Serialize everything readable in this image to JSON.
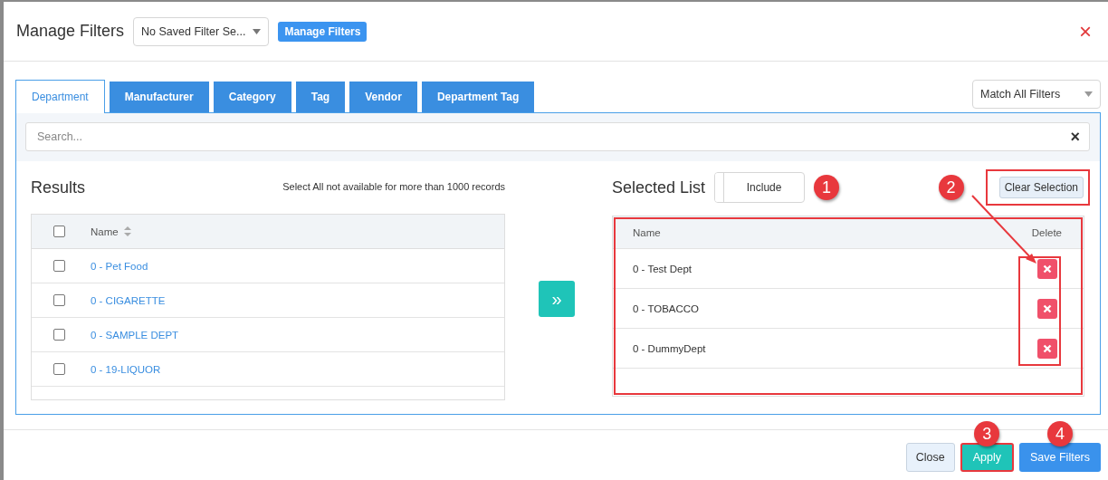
{
  "header": {
    "title": "Manage Filters",
    "saved_filter": "No Saved Filter Se...",
    "manage_button": "Manage Filters",
    "close": "×"
  },
  "tabs": [
    {
      "label": "Department",
      "selected": true
    },
    {
      "label": "Manufacturer",
      "selected": false
    },
    {
      "label": "Category",
      "selected": false
    },
    {
      "label": "Tag",
      "selected": false
    },
    {
      "label": "Vendor",
      "selected": false
    },
    {
      "label": "Department Tag",
      "selected": false
    }
  ],
  "match_select": "Match All Filters",
  "search": {
    "placeholder": "Search...",
    "clear": "×"
  },
  "results": {
    "title": "Results",
    "note": "Select All not available for more than 1000 records",
    "select_all_checked": false,
    "column": "Name",
    "rows": [
      {
        "name": "0 - Pet Food",
        "checked": false
      },
      {
        "name": "0 - CIGARETTE",
        "checked": false
      },
      {
        "name": "0 - SAMPLE DEPT",
        "checked": false
      },
      {
        "name": "0 - 19-LIQUOR",
        "checked": false
      }
    ]
  },
  "move_button": "»",
  "selected_list": {
    "title": "Selected List",
    "mode": "Include",
    "mode_callout": "1",
    "clear_button": "Clear Selection",
    "clear_callout": "2",
    "clear_highlighted": true,
    "table_highlighted": true,
    "delete_column_highlighted": true,
    "columns": [
      "Name",
      "Delete"
    ],
    "rows": [
      {
        "name": "0 - Test Dept"
      },
      {
        "name": "0 - TOBACCO"
      },
      {
        "name": "0 - DummyDept"
      }
    ]
  },
  "footer": [
    {
      "label": "Close",
      "kind": "plain",
      "highlighted": false
    },
    {
      "label": "Apply",
      "kind": "teal",
      "highlighted": true,
      "callout": "3"
    },
    {
      "label": "Save Filters",
      "kind": "blue",
      "highlighted": false,
      "callout": "4"
    }
  ]
}
